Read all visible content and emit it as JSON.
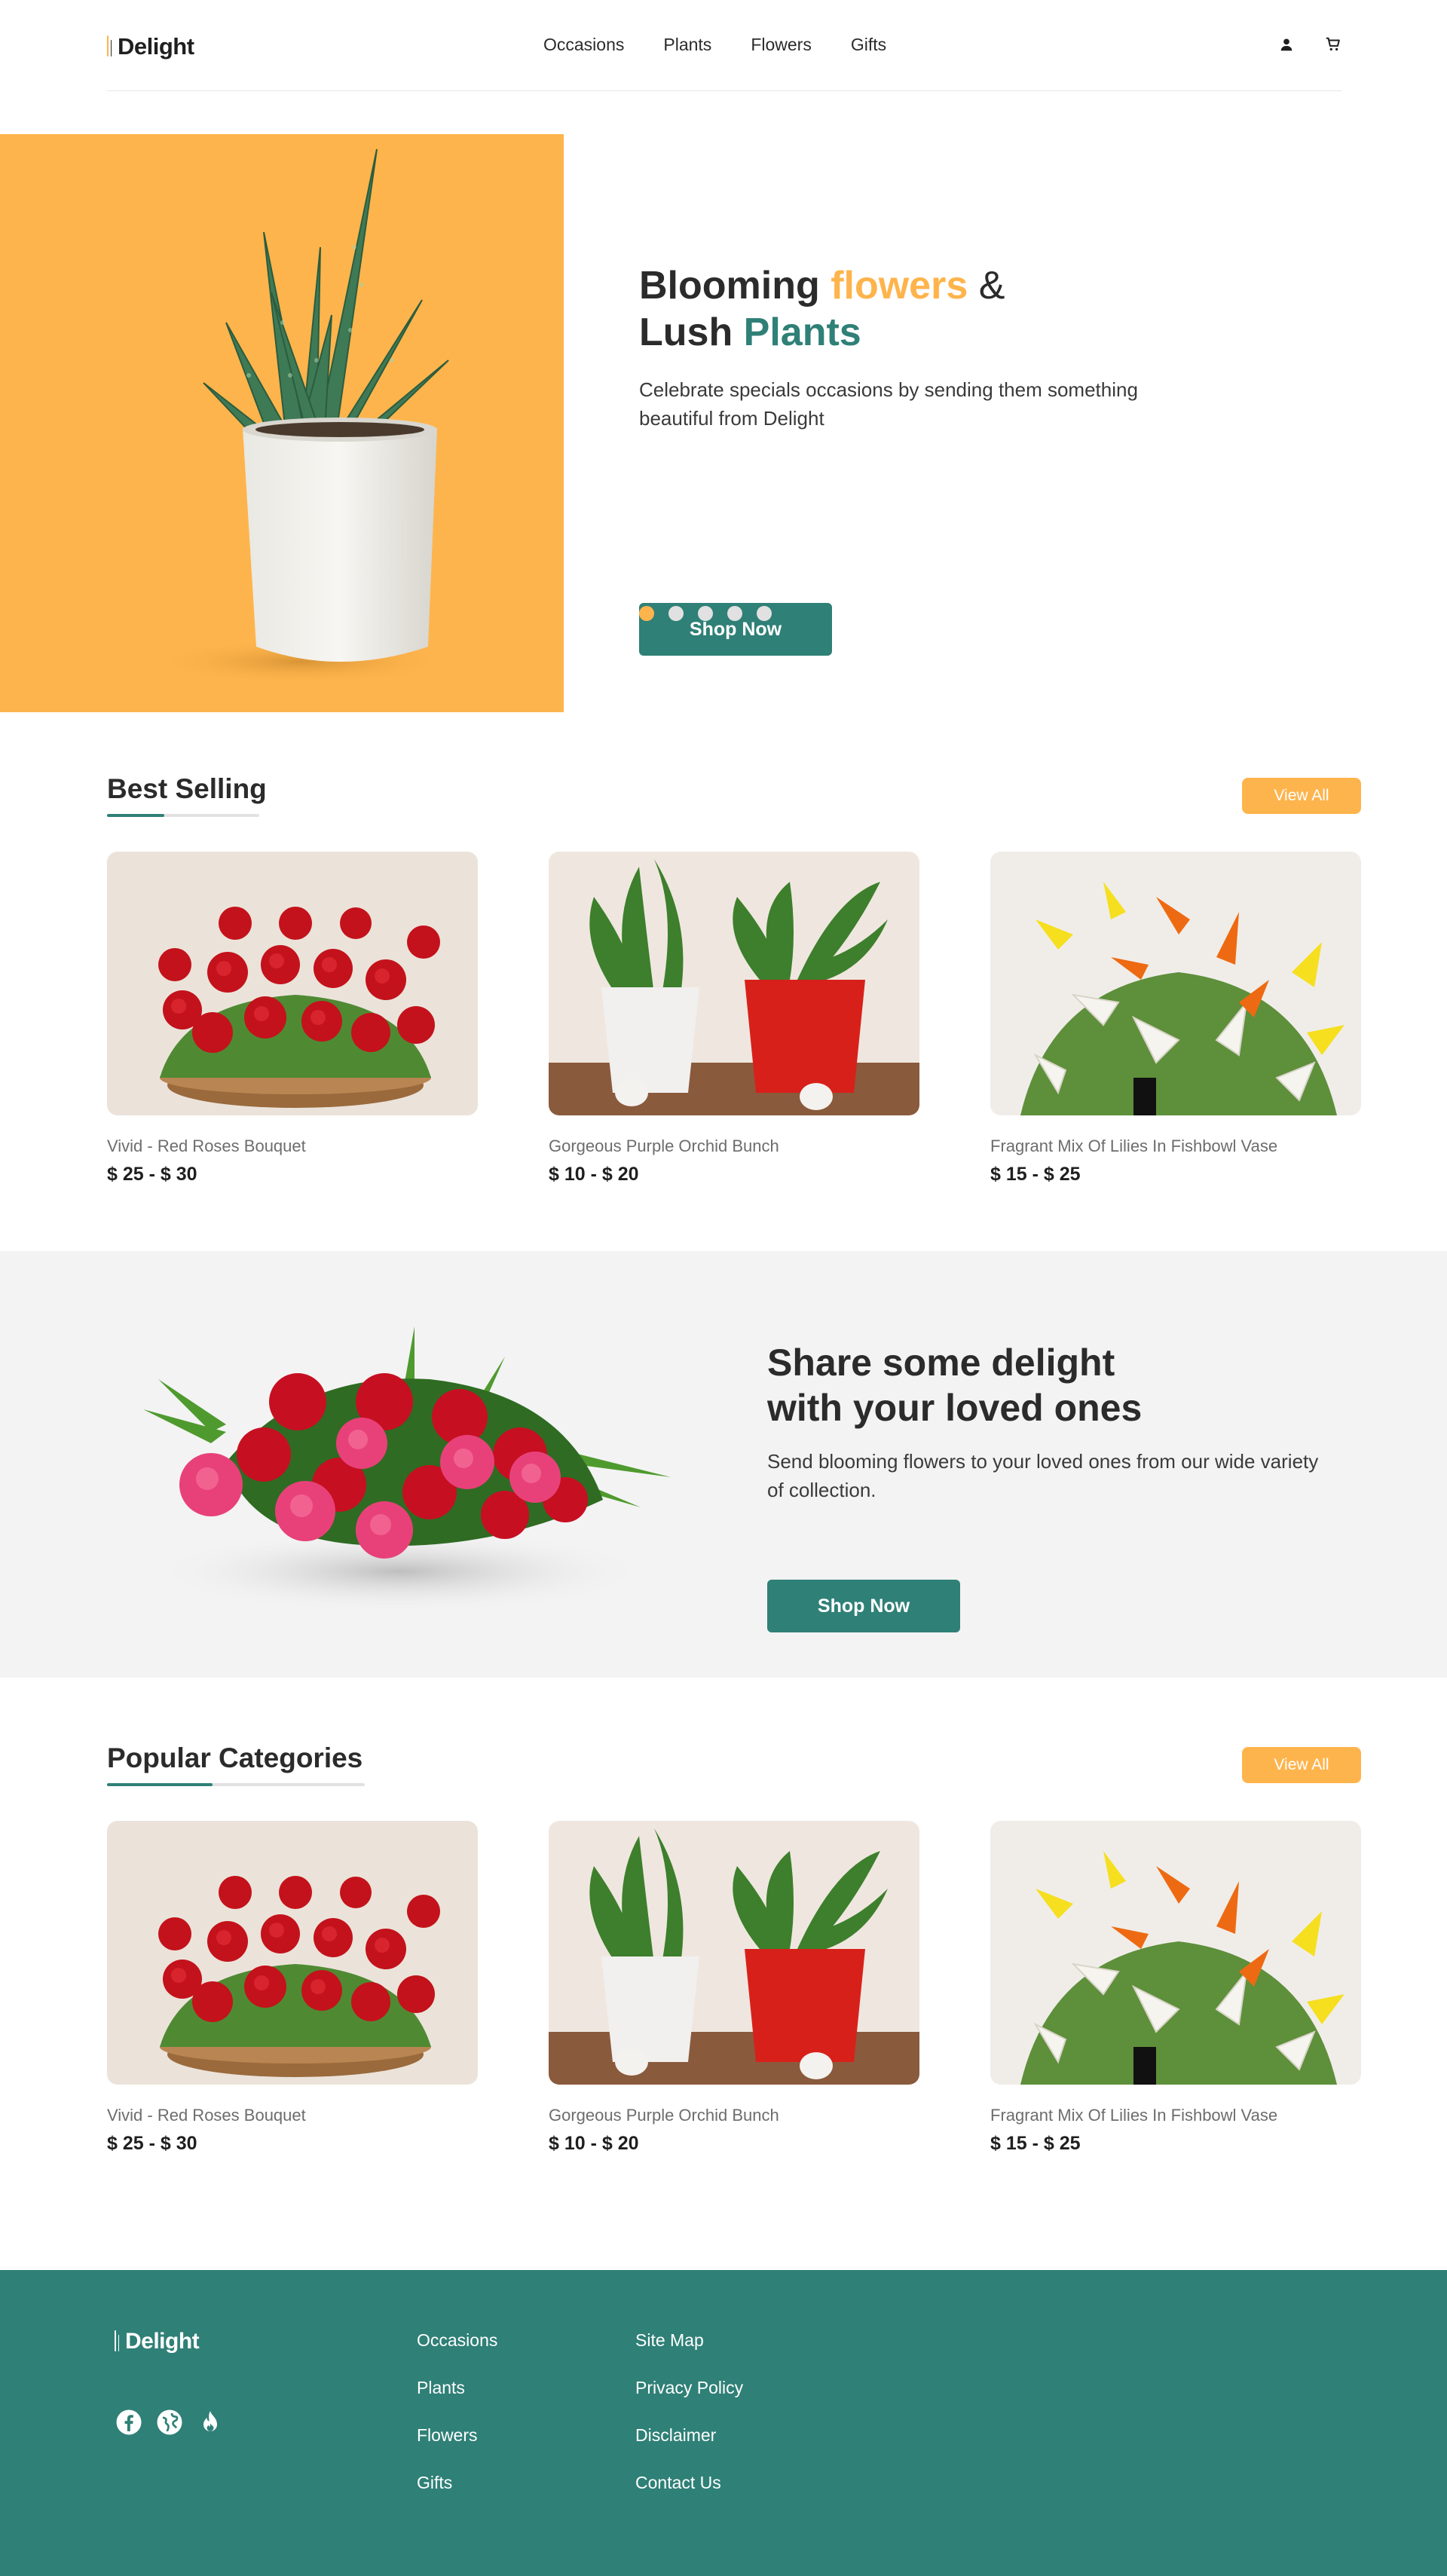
{
  "colors": {
    "accent": "#feb44c",
    "brand": "#2f8077",
    "promo_bg": "#f3f3f3"
  },
  "brand": {
    "name": "Delight"
  },
  "nav": {
    "items": [
      "Occasions",
      "Plants",
      "Flowers",
      "Gifts"
    ],
    "icons": [
      "user-icon",
      "cart-icon"
    ]
  },
  "hero": {
    "title_line1_a": "Blooming ",
    "title_line1_b": "flowers",
    "title_line1_c": " &",
    "title_line2_a": "Lush ",
    "title_line2_b": "Plants",
    "subtitle": "Celebrate specials occasions by sending them something beautiful from Delight",
    "cta": "Shop Now",
    "slides_total": 5,
    "active_slide": 1
  },
  "best_selling": {
    "title": "Best Selling",
    "view_all": "View All",
    "products": [
      {
        "name": "Vivid - Red Roses Bouquet",
        "price": "$ 25 - $ 30"
      },
      {
        "name": "Gorgeous Purple Orchid Bunch",
        "price": "$ 10 - $ 20"
      },
      {
        "name": "Fragrant Mix Of Lilies In Fishbowl Vase",
        "price": "$ 15 - $ 25"
      }
    ]
  },
  "promo": {
    "title_line1": "Share some delight",
    "title_line2": "with your loved ones",
    "subtitle": "Send blooming flowers to your loved ones from our wide variety of collection.",
    "cta": "Shop Now"
  },
  "popular": {
    "title": "Popular Categories",
    "view_all": "View All",
    "products": [
      {
        "name": "Vivid - Red Roses Bouquet",
        "price": "$ 25 - $ 30"
      },
      {
        "name": "Gorgeous Purple Orchid Bunch",
        "price": "$ 10 - $ 20"
      },
      {
        "name": "Fragrant Mix Of Lilies In Fishbowl Vase",
        "price": "$ 15 - $ 25"
      }
    ]
  },
  "footer": {
    "brand": "Delight",
    "social_icons": [
      "facebook-icon",
      "globe-icon",
      "fire-icon"
    ],
    "col1": [
      "Occasions",
      "Plants",
      "Flowers",
      "Gifts"
    ],
    "col2": [
      "Site Map",
      "Privacy Policy",
      "Disclaimer",
      "Contact Us"
    ]
  }
}
